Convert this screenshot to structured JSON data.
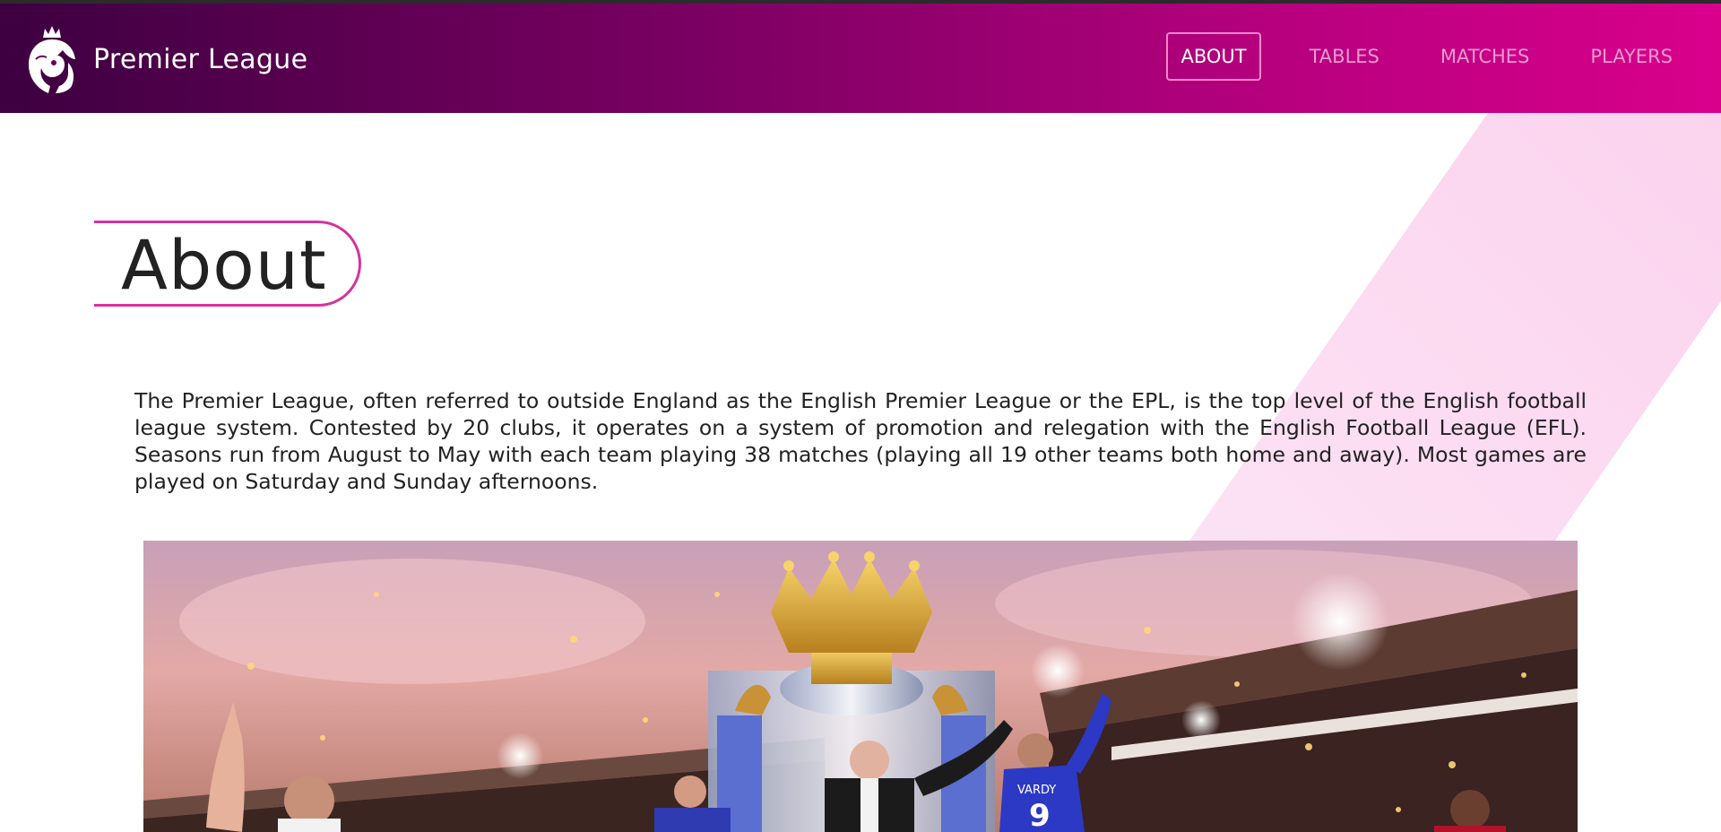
{
  "navbar": {
    "brand_name": "Premier League",
    "logo_icon": "lion-crown-icon",
    "links": [
      {
        "label": "ABOUT",
        "active": true
      },
      {
        "label": "TABLES",
        "active": false
      },
      {
        "label": "MATCHES",
        "active": false
      },
      {
        "label": "PLAYERS",
        "active": false
      }
    ]
  },
  "about": {
    "title": "About",
    "body": "The Premier League, often referred to outside England as the English Premier League or the EPL, is the top level of the English football league system. Contested by 20 clubs, it operates on a system of promotion and relegation with the English Football League (EFL). Seasons run from August to May with each team playing 38 matches (playing all 19 other teams both home and away). Most games are played on Saturday and Sunday afternoons."
  },
  "hero_image": {
    "subject": "players celebrating with the Premier League trophy",
    "shirt_text": "VARDY",
    "shirt_number": "9"
  },
  "colors": {
    "nav_gradient_start": "#3d0040",
    "nav_gradient_end": "#d9008c",
    "accent": "#d6339b",
    "stripe": "#fde6f6"
  }
}
